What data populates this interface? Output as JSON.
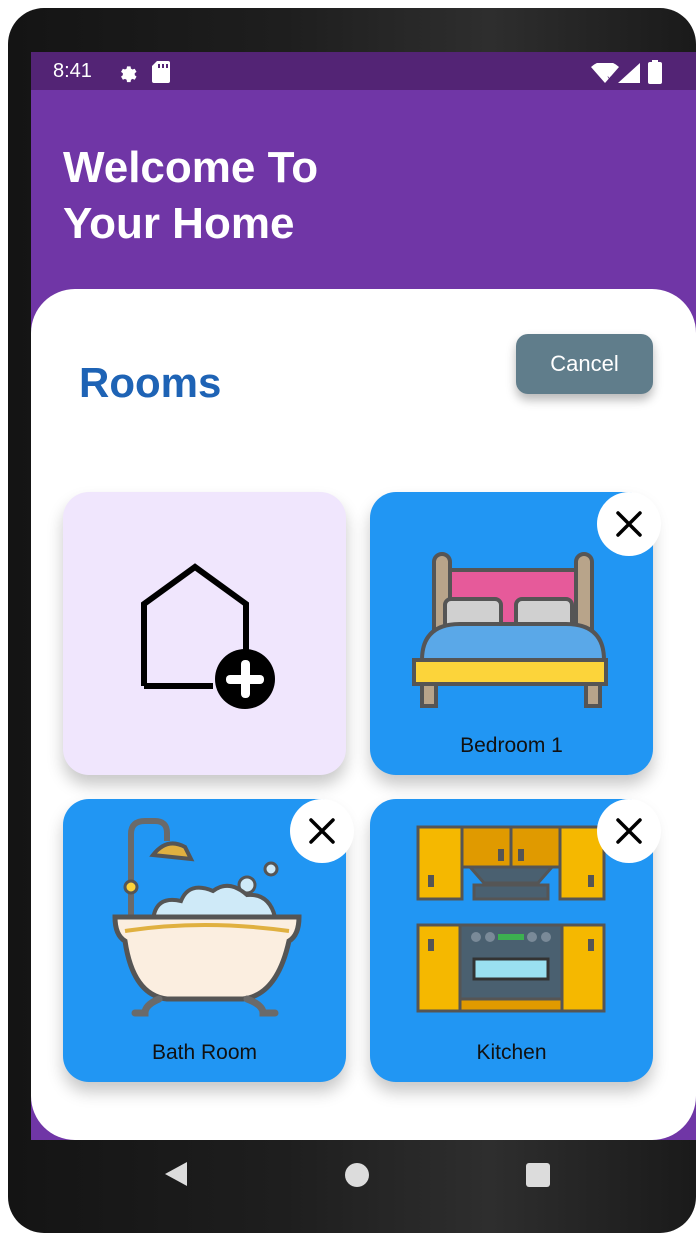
{
  "status_bar": {
    "time": "8:41",
    "icons": [
      "gear-icon",
      "sd-card-icon",
      "wifi-icon",
      "signal-icon",
      "battery-icon"
    ]
  },
  "header": {
    "title": "Welcome To\nYour Home"
  },
  "rooms_panel": {
    "title": "Rooms",
    "cancel_label": "Cancel",
    "cards": [
      {
        "label": "",
        "icon": "add-home-icon"
      },
      {
        "label": "Bedroom 1",
        "icon": "bed-icon"
      },
      {
        "label": "Bath Room",
        "icon": "bathtub-icon"
      },
      {
        "label": "Kitchen",
        "icon": "kitchen-icon"
      }
    ]
  },
  "nav_bar": {
    "icons": [
      "back-icon",
      "home-icon",
      "recents-icon"
    ]
  },
  "colors": {
    "header_bg": "#7036a6",
    "status_bg": "#532475",
    "title_blue": "#1e63b5",
    "card_blue": "#2196f3",
    "add_card_bg": "#f0e6fd",
    "cancel_bg": "#607d8b"
  }
}
